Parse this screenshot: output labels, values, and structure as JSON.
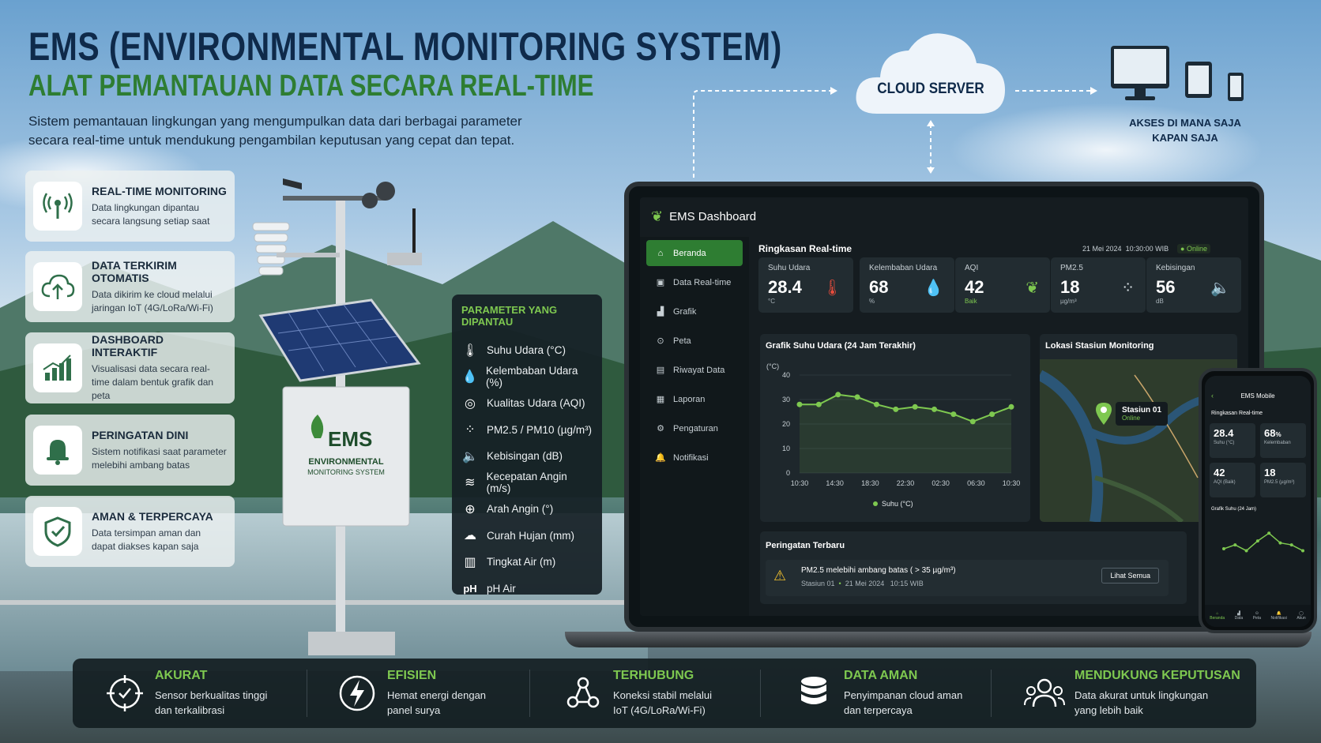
{
  "header": {
    "title": "EMS (ENVIRONMENTAL MONITORING SYSTEM)",
    "subtitle": "ALAT PEMANTAUAN DATA SECARA REAL-TIME",
    "description": "Sistem pemantauan lingkungan yang mengumpulkan data dari berbagai parameter secara real-time untuk mendukung pengambilan keputusan yang cepat dan tepat."
  },
  "cloud": {
    "label": "CLOUD SERVER"
  },
  "access": {
    "line1": "AKSES DI MANA SAJA",
    "line2": "KAPAN SAJA"
  },
  "features": [
    {
      "title": "REAL-TIME MONITORING",
      "desc": "Data lingkungan dipantau secara langsung setiap saat"
    },
    {
      "title": "DATA TERKIRIM OTOMATIS",
      "desc": "Data dikirim ke cloud melalui jaringan IoT (4G/LoRa/Wi-Fi)"
    },
    {
      "title": "DASHBOARD INTERAKTIF",
      "desc": "Visualisasi data secara real-time dalam bentuk grafik dan peta"
    },
    {
      "title": "PERINGATAN DINI",
      "desc": "Sistem notifikasi saat parameter melebihi ambang batas"
    },
    {
      "title": "AMAN & TERPERCAYA",
      "desc": "Data tersimpan aman dan dapat diakses kapan saja"
    }
  ],
  "station": {
    "brand": "EMS",
    "line1": "ENVIRONMENTAL",
    "line2": "MONITORING SYSTEM"
  },
  "params": {
    "title": "PARAMETER YANG DIPANTAU",
    "items": [
      "Suhu Udara (°C)",
      "Kelembaban Udara (%)",
      "Kualitas Udara (AQI)",
      "PM2.5 / PM10 (µg/m³)",
      "Kebisingan (dB)",
      "Kecepatan Angin (m/s)",
      "Arah Angin (°)",
      "Curah Hujan (mm)",
      "Tingkat Air (m)",
      "pH Air"
    ]
  },
  "dashboard": {
    "app_title": "EMS Dashboard",
    "section": "Ringkasan Real-time",
    "date": "21 Mei 2024",
    "time": "10:30:00 WIB",
    "status": "Online",
    "nav": [
      "Beranda",
      "Data Real-time",
      "Grafik",
      "Peta",
      "Riwayat Data",
      "Laporan",
      "Pengaturan",
      "Notifikasi"
    ],
    "kpis": [
      {
        "label": "Suhu Udara",
        "value": "28.4",
        "unit": "°C"
      },
      {
        "label": "Kelembaban Udara",
        "value": "68",
        "unit": "%"
      },
      {
        "label": "AQI",
        "value": "42",
        "unit": "Baik"
      },
      {
        "label": "PM2.5",
        "value": "18",
        "unit": "µg/m³"
      },
      {
        "label": "Kebisingan",
        "value": "56",
        "unit": "dB"
      }
    ],
    "map_title": "Lokasi Stasiun Monitoring",
    "map_station": "Stasiun 01",
    "map_status": "Online",
    "alert_title": "Peringatan Terbaru",
    "alert_text": "PM2.5 melebihi ambang batas ( > 35 µg/m³)",
    "alert_station": "Stasiun 01",
    "alert_date": "21 Mei 2024",
    "alert_time": "10:15 WIB",
    "alert_button": "Lihat Semua"
  },
  "chart_data": {
    "type": "line",
    "title": "Grafik Suhu Udara (24 Jam Terakhir)",
    "ylabel": "(°C)",
    "xlabel": "",
    "x_ticks": [
      "10:30",
      "14:30",
      "18:30",
      "22:30",
      "02:30",
      "06:30",
      "10:30"
    ],
    "y_ticks": [
      "0",
      "10",
      "20",
      "30",
      "40"
    ],
    "ylim": [
      0,
      40
    ],
    "legend": "Suhu (°C)",
    "series": [
      {
        "name": "Suhu (°C)",
        "values": [
          28,
          28,
          32,
          31,
          28,
          26,
          27,
          26,
          24,
          21,
          24,
          27
        ]
      }
    ],
    "color": "#7ec850"
  },
  "phone": {
    "title": "EMS Mobile",
    "section": "Ringkasan Real-time",
    "k1": "28.4",
    "k1l": "Suhu (°C)",
    "k2": "68",
    "k2u": "%",
    "k2l": "Kelembaban",
    "k3": "42",
    "k3l": "AQI (Baik)",
    "k4": "18",
    "k4l": "PM2.5 (µg/m³)",
    "chart_title": "Grafik Suhu (24 Jam)",
    "tabs": [
      "Beranda",
      "Data",
      "Peta",
      "Notifikasi",
      "Akun"
    ],
    "chart_values": [
      25,
      27,
      24,
      29,
      33,
      28,
      27,
      24
    ]
  },
  "benefits": [
    {
      "title": "AKURAT",
      "desc1": "Sensor berkualitas tinggi",
      "desc2": "dan terkalibrasi"
    },
    {
      "title": "EFISIEN",
      "desc1": "Hemat energi dengan",
      "desc2": "panel surya"
    },
    {
      "title": "TERHUBUNG",
      "desc1": "Koneksi stabil melalui",
      "desc2": "IoT (4G/LoRa/Wi-Fi)"
    },
    {
      "title": "DATA AMAN",
      "desc1": "Penyimpanan cloud aman",
      "desc2": "dan terpercaya"
    },
    {
      "title": "MENDUKUNG KEPUTUSAN",
      "desc1": "Data akurat untuk lingkungan",
      "desc2": "yang lebih baik"
    }
  ]
}
